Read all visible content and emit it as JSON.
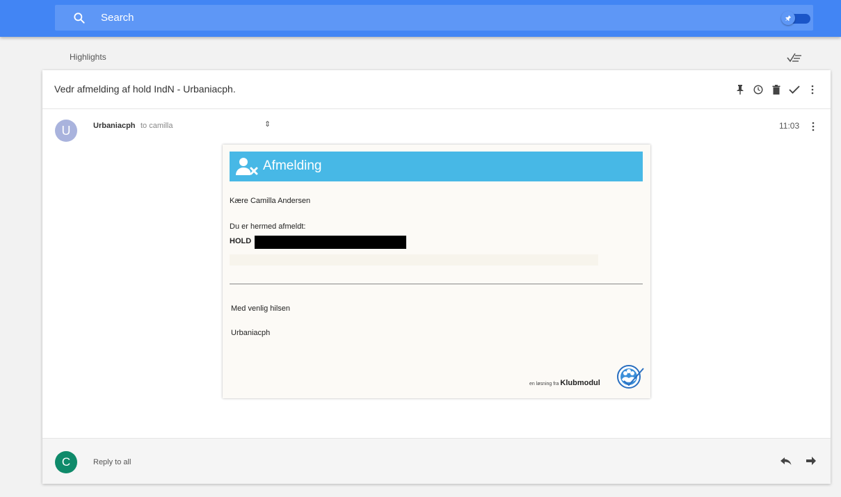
{
  "search": {
    "label": "Search"
  },
  "highlights": {
    "label": "Highlights"
  },
  "thread": {
    "subject": "Vedr afmelding af hold IndN - Urbaniacph."
  },
  "message": {
    "avatar_letter": "U",
    "sender": "Urbaniacph",
    "recipient": "to camilla",
    "expand_glyph": "⇕",
    "time": "11:03"
  },
  "email": {
    "header_title": "Afmelding",
    "greeting": "Kære Camilla Andersen",
    "unsubscribed_text": "Du er hermed afmeldt:",
    "hold_label": "HOLD",
    "regards": "Med venlig hilsen",
    "signature": "Urbaniacph",
    "brand_prefix": "en løsning fra",
    "brand_name": "Klubmodul"
  },
  "reply": {
    "avatar_letter": "C",
    "label": "Reply to all"
  },
  "colors": {
    "topbar": "#4285f4",
    "email_header": "#47b8e6",
    "avatar_u": "#a9b3dd",
    "avatar_c": "#0f8a6a"
  }
}
